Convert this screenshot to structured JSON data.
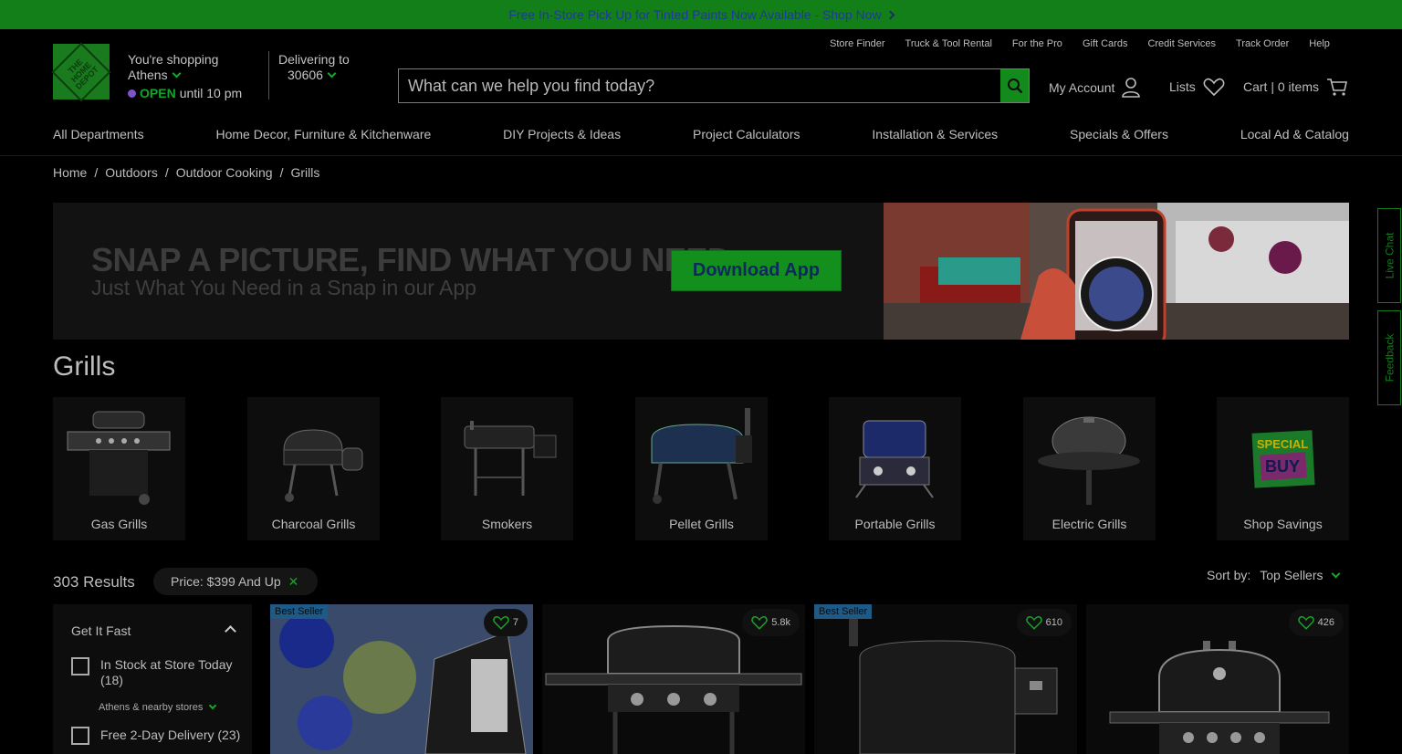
{
  "promo": {
    "text": "Free In-Store Pick Up for Tinted Paints Now Available - Shop Now"
  },
  "header": {
    "logo_text": "THE HOME DEPOT",
    "shopping_label": "You're shopping",
    "store_city": "Athens",
    "open_label": "OPEN",
    "open_hours": "until 10 pm",
    "delivering_label": "Delivering to",
    "zip": "30606",
    "top_links": [
      "Store Finder",
      "Truck & Tool Rental",
      "For the Pro",
      "Gift Cards",
      "Credit Services",
      "Track Order",
      "Help"
    ],
    "search_placeholder": "What can we help you find today?",
    "my_account": "My Account",
    "lists": "Lists",
    "cart": "Cart | 0 items"
  },
  "nav": [
    "All Departments",
    "Home Decor, Furniture & Kitchenware",
    "DIY Projects & Ideas",
    "Project Calculators",
    "Installation & Services",
    "Specials & Offers",
    "Local Ad & Catalog"
  ],
  "breadcrumbs": [
    "Home",
    "Outdoors",
    "Outdoor Cooking",
    "Grills"
  ],
  "banner": {
    "headline": "SNAP A PICTURE, FIND WHAT YOU NEED",
    "subline": "Just What You Need in a Snap in our App",
    "button": "Download App"
  },
  "side_tabs": {
    "live_chat": "Live Chat",
    "feedback": "Feedback"
  },
  "page_title": "Grills",
  "categories": [
    {
      "label": "Gas Grills",
      "icon": "gas-grill-icon"
    },
    {
      "label": "Charcoal Grills",
      "icon": "charcoal-grill-icon"
    },
    {
      "label": "Smokers",
      "icon": "smoker-icon"
    },
    {
      "label": "Pellet Grills",
      "icon": "pellet-grill-icon"
    },
    {
      "label": "Portable Grills",
      "icon": "portable-grill-icon"
    },
    {
      "label": "Electric Grills",
      "icon": "electric-grill-icon"
    },
    {
      "label": "Shop Savings",
      "icon": "special-buy-icon"
    }
  ],
  "special_buy": {
    "line1": "SPECIAL",
    "line2": "BUY"
  },
  "results": {
    "count": "303 Results",
    "filter_pill": "Price: $399 And Up",
    "sort_label": "Sort by:",
    "sort_value": "Top Sellers"
  },
  "filters": {
    "heading": "Get It Fast",
    "in_stock": "In Stock at Store Today (18)",
    "nearby": "Athens & nearby stores",
    "free_delivery": "Free 2-Day Delivery (23)"
  },
  "products": [
    {
      "badge": "Best Seller",
      "favorites": "7"
    },
    {
      "badge": "",
      "favorites": "5.8k"
    },
    {
      "badge": "Best Seller",
      "favorites": "610"
    },
    {
      "badge": "",
      "favorites": "426"
    }
  ]
}
